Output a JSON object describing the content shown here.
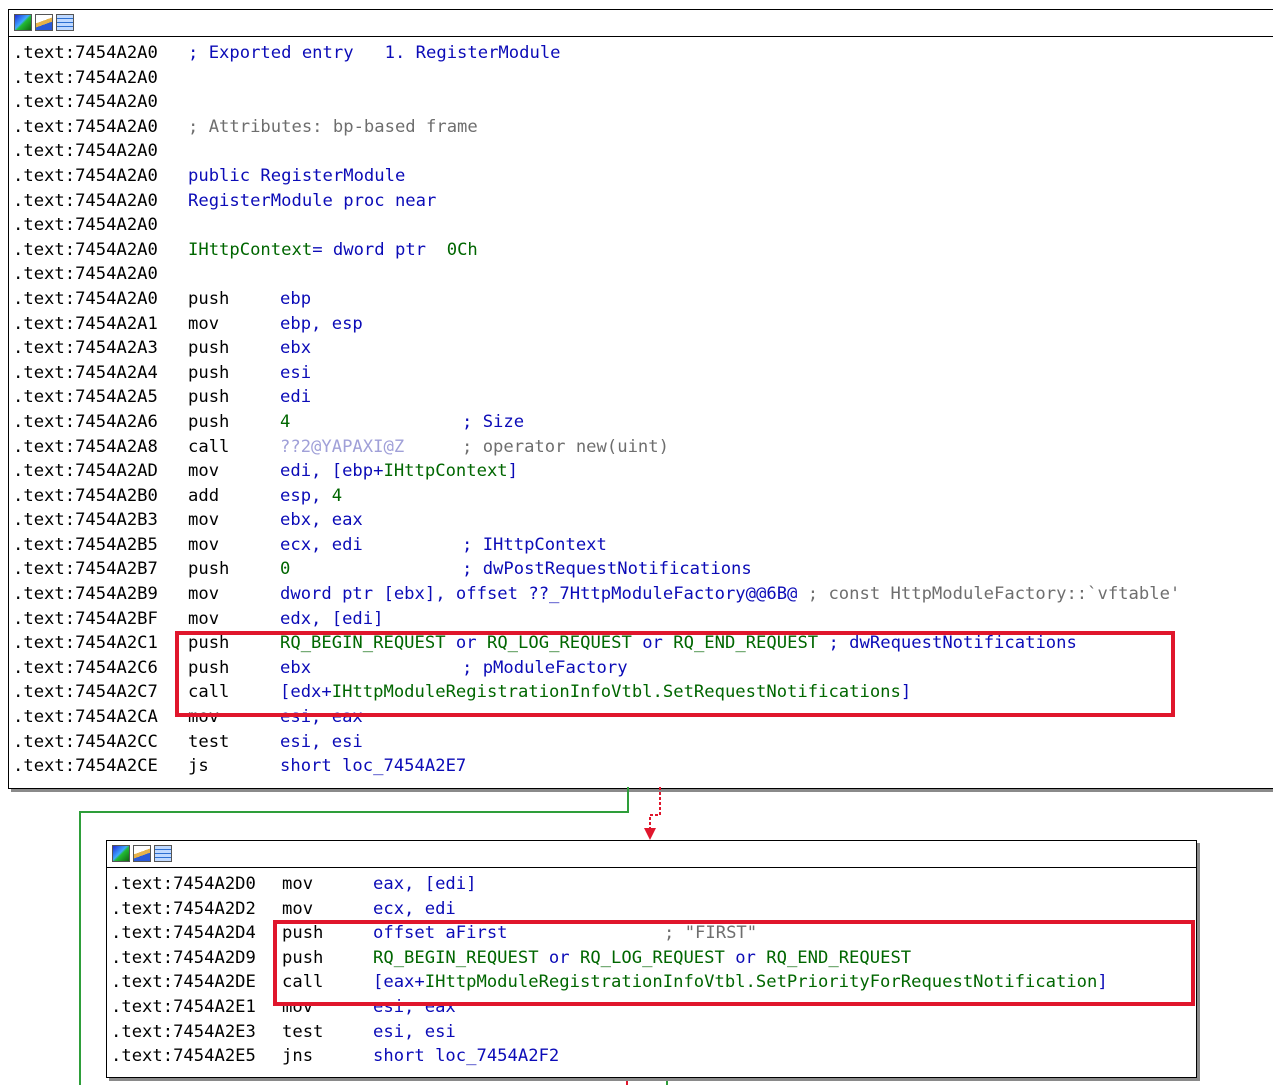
{
  "top_node": {
    "lines": [
      {
        "addr": ".text:7454A2A0",
        "kind": "raw",
        "parts": [
          {
            "t": "; Exported entry   1. RegisterModule",
            "c": "blu"
          }
        ]
      },
      {
        "addr": ".text:7454A2A0",
        "kind": "raw",
        "parts": []
      },
      {
        "addr": ".text:7454A2A0",
        "kind": "raw",
        "parts": []
      },
      {
        "addr": ".text:7454A2A0",
        "kind": "raw",
        "parts": [
          {
            "t": "; Attributes: bp-based frame",
            "c": "cmt"
          }
        ]
      },
      {
        "addr": ".text:7454A2A0",
        "kind": "raw",
        "parts": []
      },
      {
        "addr": ".text:7454A2A0",
        "kind": "raw",
        "parts": [
          {
            "t": "public RegisterModule",
            "c": "blu"
          }
        ]
      },
      {
        "addr": ".text:7454A2A0",
        "kind": "raw",
        "parts": [
          {
            "t": "RegisterModule proc near",
            "c": "blu"
          }
        ]
      },
      {
        "addr": ".text:7454A2A0",
        "kind": "raw",
        "parts": []
      },
      {
        "addr": ".text:7454A2A0",
        "kind": "raw",
        "parts": [
          {
            "t": "IHttpContext",
            "c": "grn"
          },
          {
            "t": "= dword ptr  ",
            "c": "blu"
          },
          {
            "t": "0Ch",
            "c": "grn"
          }
        ]
      },
      {
        "addr": ".text:7454A2A0",
        "kind": "raw",
        "parts": []
      },
      {
        "addr": ".text:7454A2A0",
        "kind": "ins",
        "m": "push",
        "o": [
          {
            "t": "ebp",
            "c": "blu"
          }
        ],
        "cm": []
      },
      {
        "addr": ".text:7454A2A1",
        "kind": "ins",
        "m": "mov",
        "o": [
          {
            "t": "ebp, esp",
            "c": "blu"
          }
        ],
        "cm": []
      },
      {
        "addr": ".text:7454A2A3",
        "kind": "ins",
        "m": "push",
        "o": [
          {
            "t": "ebx",
            "c": "blu"
          }
        ],
        "cm": []
      },
      {
        "addr": ".text:7454A2A4",
        "kind": "ins",
        "m": "push",
        "o": [
          {
            "t": "esi",
            "c": "blu"
          }
        ],
        "cm": []
      },
      {
        "addr": ".text:7454A2A5",
        "kind": "ins",
        "m": "push",
        "o": [
          {
            "t": "edi",
            "c": "blu"
          }
        ],
        "cm": []
      },
      {
        "addr": ".text:7454A2A6",
        "kind": "ins",
        "m": "push",
        "o": [
          {
            "t": "4",
            "c": "grn"
          }
        ],
        "cm": [
          {
            "t": "; Size",
            "c": "blu"
          }
        ]
      },
      {
        "addr": ".text:7454A2A8",
        "kind": "ins",
        "m": "call",
        "o": [
          {
            "t": "??2@YAPAXI@Z",
            "c": "imp"
          }
        ],
        "cm": [
          {
            "t": "; operator new(uint)",
            "c": "cmt"
          }
        ]
      },
      {
        "addr": ".text:7454A2AD",
        "kind": "ins",
        "m": "mov",
        "o": [
          {
            "t": "edi, [ebp+",
            "c": "blu"
          },
          {
            "t": "IHttpContext",
            "c": "grn"
          },
          {
            "t": "]",
            "c": "blu"
          }
        ],
        "cm": []
      },
      {
        "addr": ".text:7454A2B0",
        "kind": "ins",
        "m": "add",
        "o": [
          {
            "t": "esp, ",
            "c": "blu"
          },
          {
            "t": "4",
            "c": "grn"
          }
        ],
        "cm": []
      },
      {
        "addr": ".text:7454A2B3",
        "kind": "ins",
        "m": "mov",
        "o": [
          {
            "t": "ebx, eax",
            "c": "blu"
          }
        ],
        "cm": []
      },
      {
        "addr": ".text:7454A2B5",
        "kind": "ins",
        "m": "mov",
        "o": [
          {
            "t": "ecx, edi",
            "c": "blu"
          }
        ],
        "cm": [
          {
            "t": "; IHttpContext",
            "c": "blu"
          }
        ]
      },
      {
        "addr": ".text:7454A2B7",
        "kind": "ins",
        "m": "push",
        "o": [
          {
            "t": "0",
            "c": "grn"
          }
        ],
        "cm": [
          {
            "t": "; dwPostRequestNotifications",
            "c": "blu"
          }
        ]
      },
      {
        "addr": ".text:7454A2B9",
        "kind": "ins",
        "m": "mov",
        "o": [
          {
            "t": "dword ptr [ebx], offset ??_7HttpModuleFactory@@6B@ ",
            "c": "blu"
          },
          {
            "t": "; const HttpModuleFactory::`vftable'",
            "c": "cmt"
          }
        ],
        "cm": []
      },
      {
        "addr": ".text:7454A2BF",
        "kind": "ins",
        "m": "mov",
        "o": [
          {
            "t": "edx, [edi]",
            "c": "blu"
          }
        ],
        "cm": []
      },
      {
        "addr": ".text:7454A2C1",
        "kind": "ins",
        "m": "push",
        "o": [
          {
            "t": "RQ_BEGIN_REQUEST",
            "c": "grn"
          },
          {
            "t": " or ",
            "c": "blu"
          },
          {
            "t": "RQ_LOG_REQUEST",
            "c": "grn"
          },
          {
            "t": " or ",
            "c": "blu"
          },
          {
            "t": "RQ_END_REQUEST",
            "c": "grn"
          },
          {
            "t": " ; dwRequestNotifications",
            "c": "blu"
          }
        ],
        "cm": []
      },
      {
        "addr": ".text:7454A2C6",
        "kind": "ins",
        "m": "push",
        "o": [
          {
            "t": "ebx",
            "c": "blu"
          }
        ],
        "cm": [
          {
            "t": "; pModuleFactory",
            "c": "blu"
          }
        ]
      },
      {
        "addr": ".text:7454A2C7",
        "kind": "ins",
        "m": "call",
        "o": [
          {
            "t": "[edx+",
            "c": "blu"
          },
          {
            "t": "IHttpModuleRegistrationInfoVtbl.SetRequestNotifications",
            "c": "grn"
          },
          {
            "t": "]",
            "c": "blu"
          }
        ],
        "cm": []
      },
      {
        "addr": ".text:7454A2CA",
        "kind": "ins",
        "m": "mov",
        "o": [
          {
            "t": "esi, eax",
            "c": "blu"
          }
        ],
        "cm": []
      },
      {
        "addr": ".text:7454A2CC",
        "kind": "ins",
        "m": "test",
        "o": [
          {
            "t": "esi, esi",
            "c": "blu"
          }
        ],
        "cm": []
      },
      {
        "addr": ".text:7454A2CE",
        "kind": "ins",
        "m": "js",
        "o": [
          {
            "t": "short loc_7454A2E7",
            "c": "blu"
          }
        ],
        "cm": []
      }
    ]
  },
  "bottom_node": {
    "lines": [
      {
        "addr": ".text:7454A2D0",
        "kind": "ins",
        "m": "mov",
        "o": [
          {
            "t": "eax, [edi]",
            "c": "blu"
          }
        ],
        "cm": []
      },
      {
        "addr": ".text:7454A2D2",
        "kind": "ins",
        "m": "mov",
        "o": [
          {
            "t": "ecx, edi",
            "c": "blu"
          }
        ],
        "cm": []
      },
      {
        "addr": ".text:7454A2D4",
        "kind": "ins",
        "m": "push",
        "o": [
          {
            "t": "offset aFirst",
            "c": "blu"
          }
        ],
        "cm": [
          {
            "t": "; \"FIRST\"",
            "c": "cmt"
          }
        ]
      },
      {
        "addr": ".text:7454A2D9",
        "kind": "ins",
        "m": "push",
        "o": [
          {
            "t": "RQ_BEGIN_REQUEST",
            "c": "grn"
          },
          {
            "t": " or ",
            "c": "blu"
          },
          {
            "t": "RQ_LOG_REQUEST",
            "c": "grn"
          },
          {
            "t": " or ",
            "c": "blu"
          },
          {
            "t": "RQ_END_REQUEST",
            "c": "grn"
          }
        ],
        "cm": []
      },
      {
        "addr": ".text:7454A2DE",
        "kind": "ins",
        "m": "call",
        "o": [
          {
            "t": "[eax+",
            "c": "blu"
          },
          {
            "t": "IHttpModuleRegistrationInfoVtbl.SetPriorityForRequestNotification",
            "c": "grn"
          },
          {
            "t": "]",
            "c": "blu"
          }
        ],
        "cm": []
      },
      {
        "addr": ".text:7454A2E1",
        "kind": "ins",
        "m": "mov",
        "o": [
          {
            "t": "esi, eax",
            "c": "blu"
          }
        ],
        "cm": []
      },
      {
        "addr": ".text:7454A2E3",
        "kind": "ins",
        "m": "test",
        "o": [
          {
            "t": "esi, esi",
            "c": "blu"
          }
        ],
        "cm": []
      },
      {
        "addr": ".text:7454A2E5",
        "kind": "ins",
        "m": "jns",
        "o": [
          {
            "t": "short loc_7454A2F2",
            "c": "blu"
          }
        ],
        "cm": []
      }
    ]
  },
  "toolbar_icons": [
    "graph-overview-icon",
    "edit-node-icon",
    "text-view-icon"
  ],
  "colors": {
    "highlight": "#e0162c",
    "edge_true": "#2e9e3a",
    "edge_false": "#e0162c",
    "keyword": "#0b0bb7",
    "constant": "#006600"
  }
}
